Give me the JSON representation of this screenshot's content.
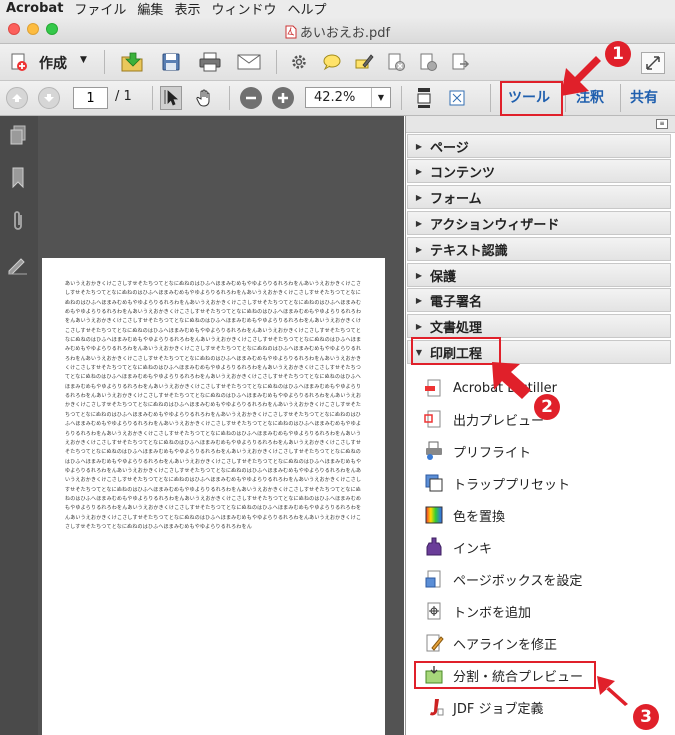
{
  "menubar": {
    "app": "Acrobat",
    "items": [
      "ファイル",
      "編集",
      "表示",
      "ウィンドウ",
      "ヘルプ"
    ]
  },
  "window": {
    "title": "あいおえお.pdf"
  },
  "toolbar": {
    "create_label": "作成",
    "page_current": "1",
    "page_total": "/ 1",
    "zoom": "42.2%",
    "tabs": {
      "tools": "ツール",
      "comment": "注釈",
      "share": "共有"
    }
  },
  "document": {
    "text": "あいうえおかきくけこさしすせそたちつてとなにぬねのはひふへほまみむめもやゆよらりるれろわをんあいうえおかきくけこさしすせそたちつてとなにぬねのはひふへほまみむめもやゆよらりるれろわをんあいうえおかきくけこさしすせそたちつてとなにぬねのはひふへほまみむめもやゆよらりるれろわをんあいうえおかきくけこさしすせそたちつてとなにぬねのはひふへほまみむめもやゆよらりるれろわをんあいうえおかきくけこさしすせそたちつてとなにぬねのはひふへほまみむめもやゆよらりるれろわをんあいうえおかきくけこさしすせそたちつてとなにぬねのはひふへほまみむめもやゆよらりるれろわをんあいうえおかきくけこさしすせそたちつてとなにぬねのはひふへほまみむめもやゆよらりるれろわをんあいうえおかきくけこさしすせそたちつてとなにぬねのはひふへほまみむめもやゆよらりるれろわをんあいうえおかきくけこさしすせそたちつてとなにぬねのはひふへほまみむめもやゆよらりるれろわをんあいうえおかきくけこさしすせそたちつてとなにぬねのはひふへほまみむめもやゆよらりるれろわをんあいうえおかきくけこさしすせそたちつてとなにぬねのはひふへほまみむめもやゆよらりるれろわをんあいうえおかきくけこさしすせそたちつてとなにぬねのはひふへほまみむめもやゆよらりるれろわをんあいうえおかきくけこさしすせそたちつてとなにぬねのはひふへほまみむめもやゆよらりるれろわをんあいうえおかきくけこさしすせそたちつてとなにぬねのはひふへほまみむめもやゆよらりるれろわをんあいうえおかきくけこさしすせそたちつてとなにぬねのはひふへほまみむめもやゆよらりるれろわをんあいうえおかきくけこさしすせそたちつてとなにぬねのはひふへほまみむめもやゆよらりるれろわをんあいうえおかきくけこさしすせそたちつてとなにぬねのはひふへほまみむめもやゆよらりるれろわをんあいうえおかきくけこさしすせそたちつてとなにぬねのはひふへほまみむめもやゆよらりるれろわをんあいうえおかきくけこさしすせそたちつてとなにぬねのはひふへほまみむめもやゆよらりるれろわをんあいうえおかきくけこさしすせそたちつてとなにぬねのはひふへほまみむめもやゆよらりるれろわをんあいうえおかきくけこさしすせそたちつてとなにぬねのはひふへほまみむめもやゆよらりるれろわをんあいうえおかきくけこさしすせそたちつてとなにぬねのはひふへほまみむめもやゆよらりるれろわをんあいうえおかきくけこさしすせそたちつてとなにぬねのはひふへほまみむめもやゆよらりるれろわをんあいうえおかきくけこさしすせそたちつてとなにぬねのはひふへほまみむめもやゆよらりるれろわをんあいうえおかきくけこさしすせそたちつてとなにぬねのはひふへほまみむめもやゆよらりるれろわをんあいうえおかきくけこさしすせそたちつてとなにぬねのはひふへほまみむめもやゆよらりるれろわをんあいうえおかきくけこさしすせそたちつてとなにぬねのはひふへほまみむめもやゆよらりるれろわをんあいうえおかきくけこさしすせそたちつてとなにぬねのはひふへほまみむめもやゆよらりるれろわをんあいうえおかきくけこさしすせそたちつてとなにぬねのはひふへほまみむめもやゆよらりるれろわをんあいうえおかきくけこさしすせそたちつてとなにぬねのはひふへほまみむめもやゆよらりるれろわをんあいうえおかきくけこさしすせそたちつてとなにぬねのはひふへほまみむめもやゆよらりるれろわをんあいうえおかきくけこさしすせそたちつてとなにぬねのはひふへほまみむめもやゆよらりるれろわをんあいうえおかきくけこさしすせそたちつてとなにぬねのはひふへほまみむめもやゆよらりるれろわをん"
  },
  "tool_pane": {
    "sections": [
      {
        "label": "ページ",
        "expanded": false
      },
      {
        "label": "コンテンツ",
        "expanded": false
      },
      {
        "label": "フォーム",
        "expanded": false
      },
      {
        "label": "アクションウィザード",
        "expanded": false
      },
      {
        "label": "テキスト認識",
        "expanded": false
      },
      {
        "label": "保護",
        "expanded": false
      },
      {
        "label": "電子署名",
        "expanded": false
      },
      {
        "label": "文書処理",
        "expanded": false
      },
      {
        "label": "印刷工程",
        "expanded": true
      }
    ],
    "print_tools": [
      {
        "label": "Acrobat Distiller",
        "icon": "distiller-icon"
      },
      {
        "label": "出力プレビュー",
        "icon": "output-preview-icon"
      },
      {
        "label": "プリフライト",
        "icon": "preflight-icon"
      },
      {
        "label": "トラッププリセット",
        "icon": "trap-presets-icon"
      },
      {
        "label": "色を置換",
        "icon": "convert-colors-icon"
      },
      {
        "label": "インキ",
        "icon": "ink-manager-icon"
      },
      {
        "label": "ページボックスを設定",
        "icon": "page-boxes-icon"
      },
      {
        "label": "トンボを追加",
        "icon": "printer-marks-icon"
      },
      {
        "label": "ヘアラインを修正",
        "icon": "fix-hairlines-icon"
      },
      {
        "label": "分割・統合プレビュー",
        "icon": "flattener-preview-icon"
      },
      {
        "label": "JDF ジョブ定義",
        "icon": "jdf-job-icon"
      }
    ]
  },
  "annotations": {
    "step1": "1",
    "step2": "2",
    "step3": "3",
    "highlight_color": "#e0202a"
  }
}
